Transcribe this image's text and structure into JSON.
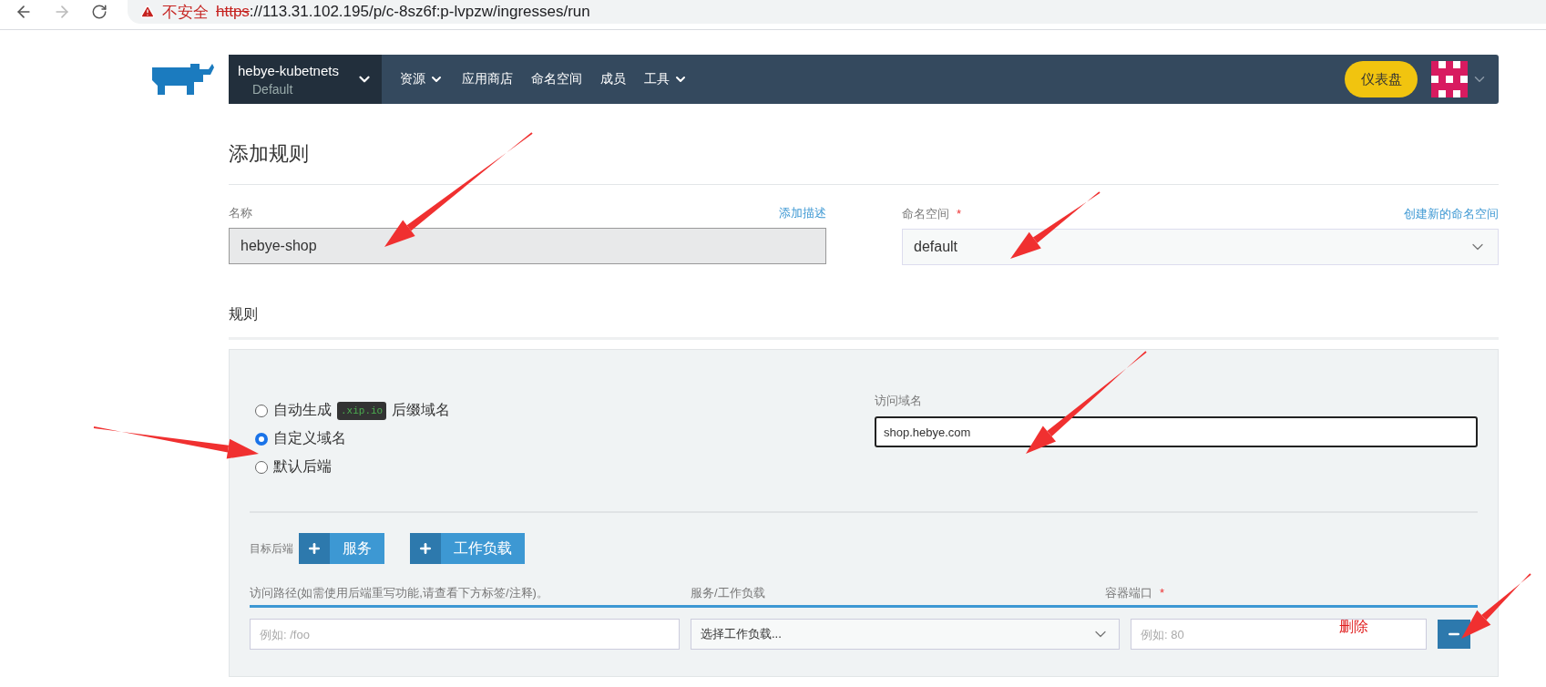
{
  "browser": {
    "security_warning": "不安全",
    "url_scheme": "https",
    "url_rest": "://113.31.102.195/p/c-8sz6f:p-lvpzw/ingresses/run"
  },
  "nav": {
    "cluster": "hebye-kubetnets",
    "project": "Default",
    "items": [
      {
        "label": "资源",
        "dropdown": true
      },
      {
        "label": "应用商店",
        "dropdown": false
      },
      {
        "label": "命名空间",
        "dropdown": false
      },
      {
        "label": "成员",
        "dropdown": false
      },
      {
        "label": "工具",
        "dropdown": true
      }
    ],
    "dashboard": "仪表盘"
  },
  "form": {
    "title": "添加规则",
    "name_label": "名称",
    "add_description": "添加描述",
    "name_value": "hebye-shop",
    "namespace_label": "命名空间",
    "namespace_required": "*",
    "create_namespace": "创建新的命名空间",
    "namespace_value": "default"
  },
  "rules": {
    "heading": "规则",
    "host_options": [
      {
        "kind": "auto",
        "prefix": "自动生成",
        "code": ".xip.io",
        "suffix": "后缀域名",
        "selected": false
      },
      {
        "kind": "plain",
        "prefix": "自定义域名",
        "selected": true
      },
      {
        "kind": "plain",
        "prefix": "默认后端",
        "selected": false
      }
    ],
    "domain_label": "访问域名",
    "domain_value": "shop.hebye.com",
    "target_label": "目标后端",
    "target_buttons": [
      "服务",
      "工作负载"
    ],
    "columns": [
      {
        "label": "访问路径(如需使用后端重写功能,请查看下方标签/注释)。"
      },
      {
        "label": "服务/工作负载"
      },
      {
        "label": "容器端口",
        "required": "*"
      }
    ],
    "path_placeholder": "例如: /foo",
    "workload_placeholder": "选择工作负载...",
    "port_placeholder": "例如: 80"
  },
  "annotation": "删除"
}
